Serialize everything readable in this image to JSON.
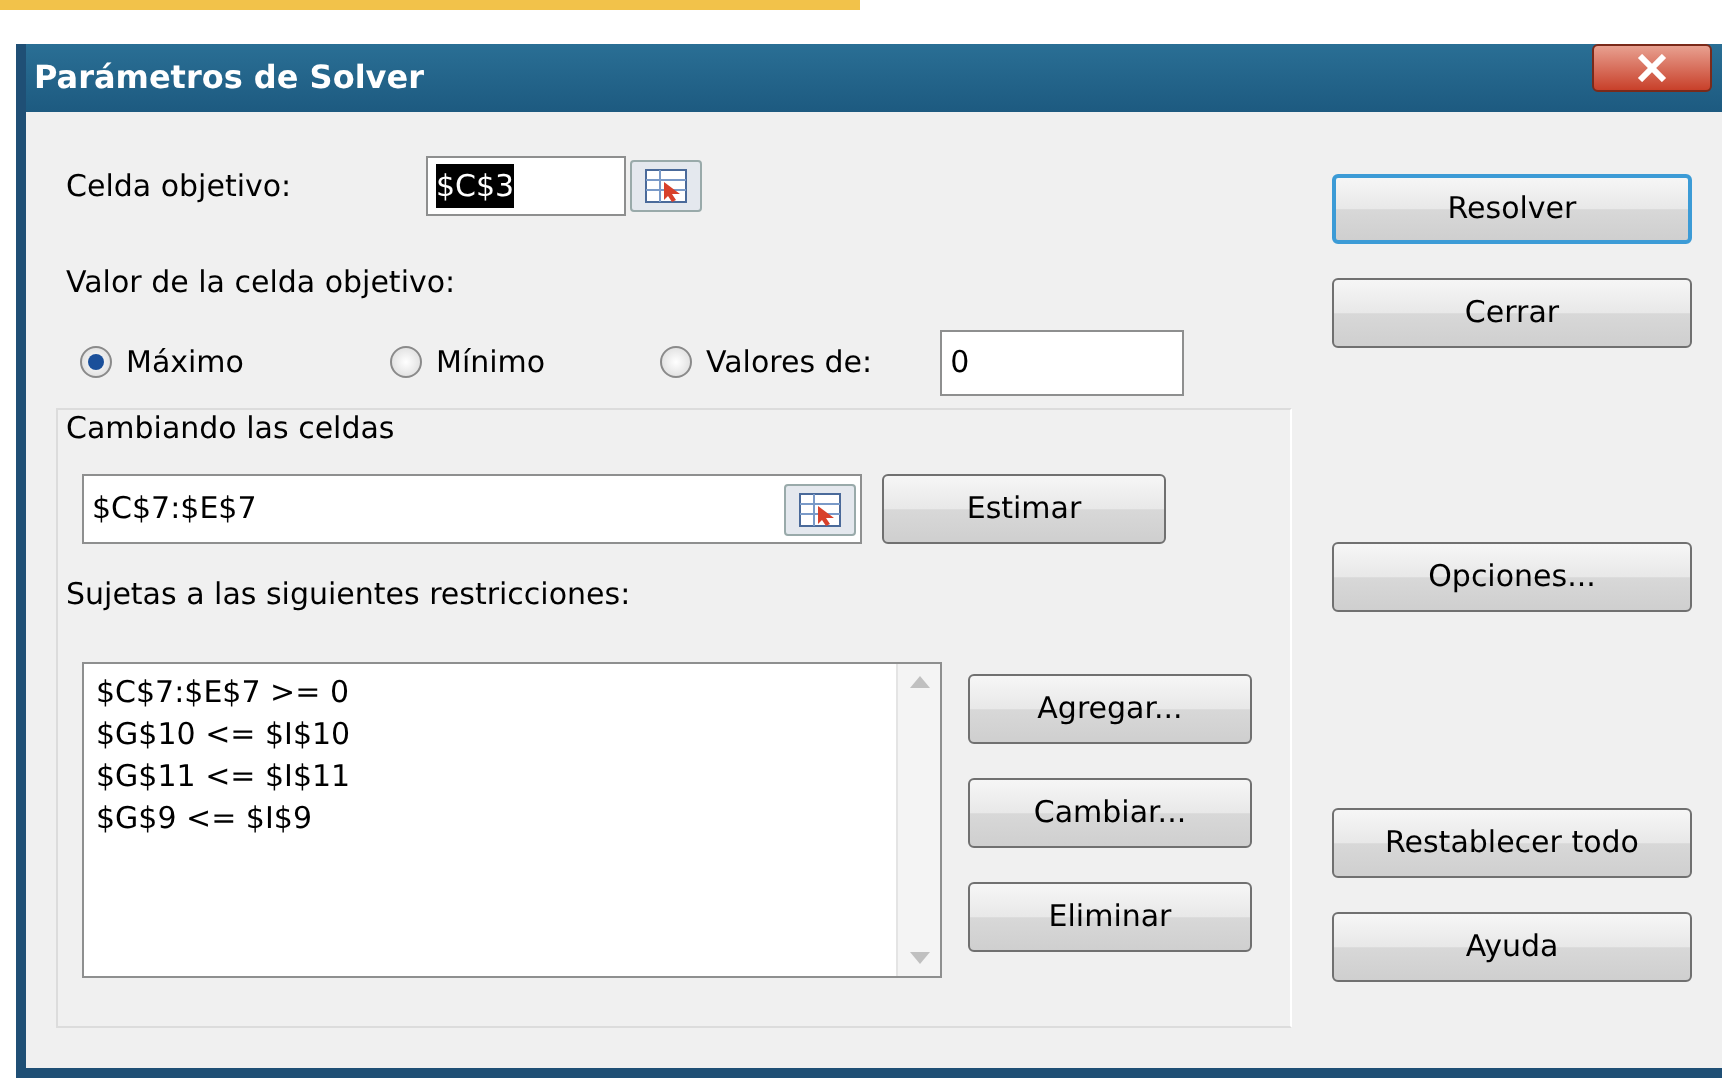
{
  "window": {
    "title": "Parámetros de Solver"
  },
  "target": {
    "label": "Celda objetivo:",
    "value": "$C$3",
    "text_selected": true
  },
  "goal": {
    "label": "Valor de la celda objetivo:",
    "options": [
      {
        "label": "Máximo",
        "selected": true
      },
      {
        "label": "Mínimo",
        "selected": false
      },
      {
        "label": "Valores de:",
        "selected": false
      }
    ],
    "value_field": "0"
  },
  "changing": {
    "title": "Cambiando las celdas",
    "value": "$C$7:$E$7",
    "button": "Estimar"
  },
  "constraints": {
    "title": "Sujetas a las siguientes restricciones:",
    "items": [
      "$C$7:$E$7 >= 0",
      "$G$10 <= $I$10",
      "$G$11 <= $I$11",
      "$G$9 <= $I$9"
    ],
    "buttons": [
      "Agregar...",
      "Cambiar...",
      "Eliminar"
    ]
  },
  "side_buttons": [
    {
      "label": "Resolver",
      "default": true
    },
    {
      "label": "Cerrar",
      "default": false
    },
    {
      "label": "Opciones...",
      "default": false
    },
    {
      "label": "Restablecer todo",
      "default": false
    },
    {
      "label": "Ayuda",
      "default": false
    }
  ]
}
